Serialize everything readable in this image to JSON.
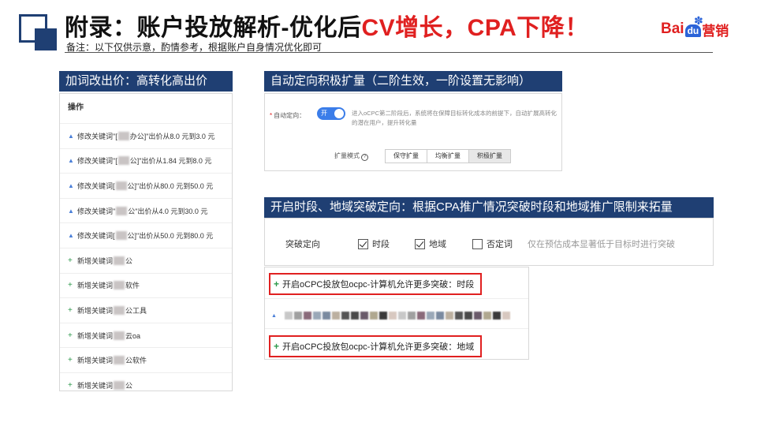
{
  "header": {
    "title_dark": "附录：账户投放解析-优化后",
    "title_red": "CV增长，CPA下降！",
    "note": "备注：以下仅供示意，酌情参考，根据账户自身情况优化即可",
    "logo_bai": "Bai",
    "logo_du": "du",
    "logo_ying": "营销",
    "logo_icon": "baidu-paw-icon"
  },
  "colors": {
    "accent": "#1f3f73",
    "red": "#e02020",
    "toggle_blue": "#3b7de9",
    "plus_green": "#2e9a4c"
  },
  "section_left": {
    "heading": "加词改出价：高转化高出价",
    "table_header": "操作",
    "rows": [
      {
        "type": "modify",
        "pre": "修改关键词\"[",
        "post": "办公]\"出价从8.0 元到3.0 元"
      },
      {
        "type": "modify",
        "pre": "修改关键词\"[",
        "post": "公]\"出价从1.84 元到8.0 元"
      },
      {
        "type": "modify",
        "pre": "修改关键词[",
        "post": "公]\"出价从80.0 元到50.0 元"
      },
      {
        "type": "modify",
        "pre": "修改关键词\"",
        "post": "公\"出价从4.0 元到30.0 元"
      },
      {
        "type": "modify",
        "pre": "修改关键词[",
        "post": "公]\"出价从50.0 元到80.0 元"
      },
      {
        "type": "add",
        "pre": "新增关键词",
        "post": "公"
      },
      {
        "type": "add",
        "pre": "新增关键词",
        "post": "软件"
      },
      {
        "type": "add",
        "pre": "新增关键词",
        "post": "公工具"
      },
      {
        "type": "add",
        "pre": "新增关键词",
        "post": "云oa"
      },
      {
        "type": "add",
        "pre": "新增关键词",
        "post": "公软件"
      },
      {
        "type": "add",
        "pre": "新增关键词",
        "post": "公"
      }
    ]
  },
  "section_right_top": {
    "heading": "自动定向积极扩量（二阶生效，一阶设置无影响）",
    "auto_targeting_label": "自动定向：",
    "toggle_label": "开",
    "description": "进入oCPC第二阶段后，系统将在保障目标转化成本的前提下，自动扩展高转化的潜在用户，提升转化量",
    "mode_label": "扩量模式",
    "modes": [
      "保守扩量",
      "均衡扩量",
      "积极扩量"
    ],
    "active_mode": "积极扩量"
  },
  "section_right_bottom": {
    "heading": "开启时段、地域突破定向：根据CPA推广情况突破时段和地域推广限制来拓量",
    "breakthrough_label": "突破定向",
    "options": [
      {
        "label": "时段",
        "checked": true
      },
      {
        "label": "地域",
        "checked": true
      },
      {
        "label": "否定词",
        "checked": false
      }
    ],
    "note": "仅在预估成本显著低于目标时进行突破",
    "log_entries": [
      "开启oCPC投放包ocpc-计算机允许更多突破：时段",
      "开启oCPC投放包ocpc-计算机允许更多突破：地域"
    ]
  }
}
